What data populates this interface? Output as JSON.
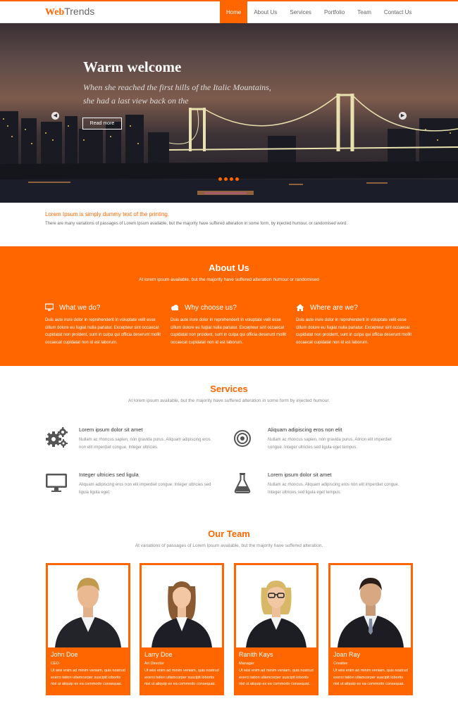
{
  "header": {
    "logo_web": "Web",
    "logo_trends": "Trends",
    "nav": [
      "Home",
      "About Us",
      "Services",
      "Portfolio",
      "Team",
      "Contact Us"
    ],
    "active_nav": "Home"
  },
  "hero": {
    "title": "Warm welcome",
    "subtitle": "When she reached the first hills of the Italic Mountains, she had a last view back on the",
    "button": "Read more",
    "prev_icon": "chevron-left-icon",
    "next_icon": "chevron-right-icon",
    "slide_dots": 4
  },
  "intro": {
    "heading": "Lorem Ipsum is simply dummy text of the printing.",
    "text": "There are many variations of passages of Lorem Ipsum available, but the majority have suffered alteration in some form, by injected humour, or randomised word."
  },
  "about": {
    "title": "About Us",
    "subtitle": "At lorem ipsum available, but the majority have suffered alteration humour or randomised",
    "columns": [
      {
        "icon": "monitor-icon",
        "heading": "What we do?",
        "text": "Duis aute irure dolor in reprehenderit in voluptate velit esse cillum dolore eu fugiat nulla pariatur. Excepteur sint occaecat cupidatat non proident, sunt in culpa qui officia deserunt mollit occaecat cupidatat non id est laborum."
      },
      {
        "icon": "cloud-icon",
        "heading": "Why choose us?",
        "text": "Duis aute irure dolor in reprehenderit in voluptate velit esse cillum dolore eu fugiat nulla pariatur. Excepteur sint occaecat cupidatat non proident, sunt in culpa qui officia deserunt mollit occaecat cupidatat non id est laborum."
      },
      {
        "icon": "home-icon",
        "heading": "Where are we?",
        "text": "Duis aute irure dolor in reprehenderit in voluptate velit esse cillum dolore eu fugiat nulla pariatur. Excepteur sint occaecat cupidatat non proident, sunt in culpa qui officia deserunt mollit occaecat cupidatat non id est laborum."
      }
    ]
  },
  "services": {
    "title": "Services",
    "subtitle": "At lorem ipsum available, but the majority have suffered alteration in some form by injected humour.",
    "items": [
      {
        "icon": "gears-icon",
        "title": "Lorem ipsum dolor sit amet",
        "text": "Nullam ac rhoncus sapien, non gravida purus. Aliquam adipiscing eros non elit imperdiet congue. Integer ultricies."
      },
      {
        "icon": "target-icon",
        "title": "Aliquam adipiscing eros non elit",
        "text": "Nullam ac rhoncus sapien, non gravida purus. Alinon elit imperdiet congue. Integer ultricies sed ligula eget tempus."
      },
      {
        "icon": "monitor-icon",
        "title": "Integer ultricies sed ligula",
        "text": "Aliquam adipiscing eros non elit imperdiet congue. Integer ultricies sed ligula ligula eget."
      },
      {
        "icon": "flask-icon",
        "title": "Lorem ipsum dolor sit amet",
        "text": "Nullam ac rhoncus. Aliquam adipiscing eros non elit imperdiet congue. Integer ultricies sed ligula eget tempus."
      }
    ]
  },
  "team": {
    "title": "Our Team",
    "subtitle": "At variations of passages of Lorem Ipsum available, but the majority have suffered alteration.",
    "members": [
      {
        "name": "John Doe",
        "role": "CEO",
        "text": "Ut wisi enim ad minim veniam, quis nostrud exerci tation ullamcorper suscipit lobortis nisl ut aliquip ex ea commodo consequat.",
        "photo": "man-portrait"
      },
      {
        "name": "Larry Doe",
        "role": "Art Director",
        "text": "Ut wisi enim ad minim veniam, quis nostrud exerci tation ullamcorper suscipit lobortis nisl ut aliquip ex ea commodo consequat.",
        "photo": "woman-portrait"
      },
      {
        "name": "Ranith Kays",
        "role": "Manager",
        "text": "Ut wisi enim ad minim veniam, quis nostrud exerci tation ullamcorper suscipit lobortis nisl ut aliquip ex ea commodo consequat.",
        "photo": "woman-glasses-portrait"
      },
      {
        "name": "Joan Ray",
        "role": "Creative",
        "text": "Ut wisi enim ad minim veniam, quis nostrud exerci tation ullamcorper suscipit lobortis nisl ut aliquip ex ea commodo consequat.",
        "photo": "man-portrait"
      }
    ]
  },
  "colors": {
    "accent": "#ff6600"
  }
}
